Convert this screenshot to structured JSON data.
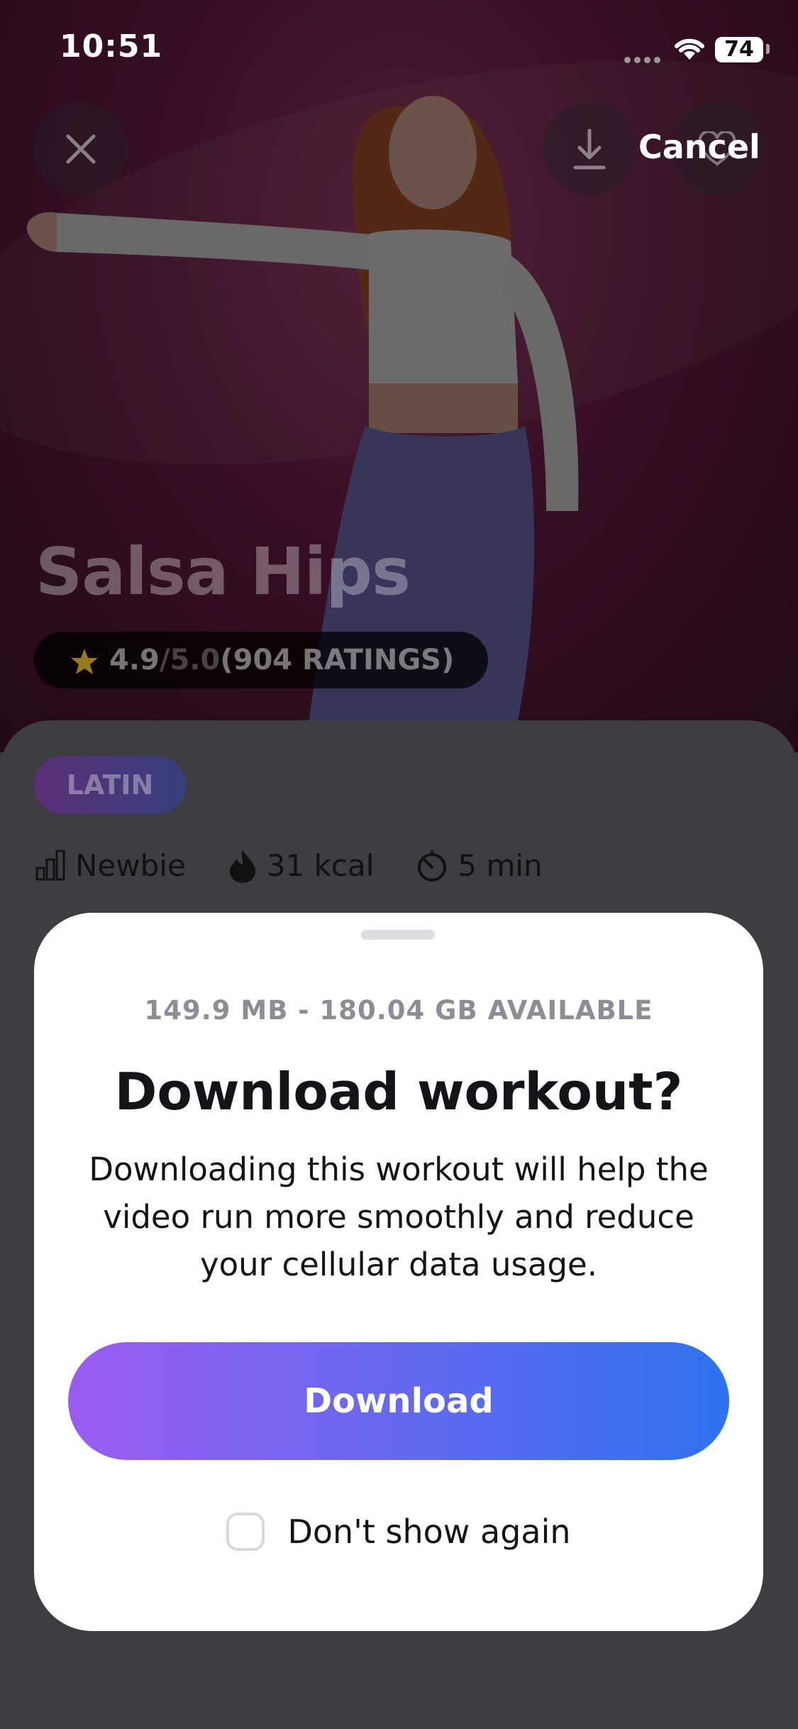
{
  "status_bar": {
    "time": "10:51",
    "battery": "74"
  },
  "header": {
    "cancel_label": "Cancel"
  },
  "workout": {
    "title": "Salsa Hips",
    "rating_value": "4.9",
    "rating_max": " /5.0",
    "ratings_count": " (904 RATINGS)",
    "tag": "LATIN",
    "stats": [
      {
        "icon": "bar-chart-icon",
        "label": "Newbie"
      },
      {
        "icon": "flame-icon",
        "label": "31 kcal"
      },
      {
        "icon": "timer-icon",
        "label": "5 min"
      }
    ]
  },
  "sheet": {
    "storage": "149.9 MB - 180.04 GB AVAILABLE",
    "title": "Download workout?",
    "body": "Downloading this workout will help the video run more smoothly and reduce your cellular data usage.",
    "download_label": "Download",
    "dont_show_label": "Don't show again"
  },
  "colors": {
    "accent_start": "#9b5cf0",
    "accent_end": "#2f72f0",
    "star": "#f2b623"
  }
}
